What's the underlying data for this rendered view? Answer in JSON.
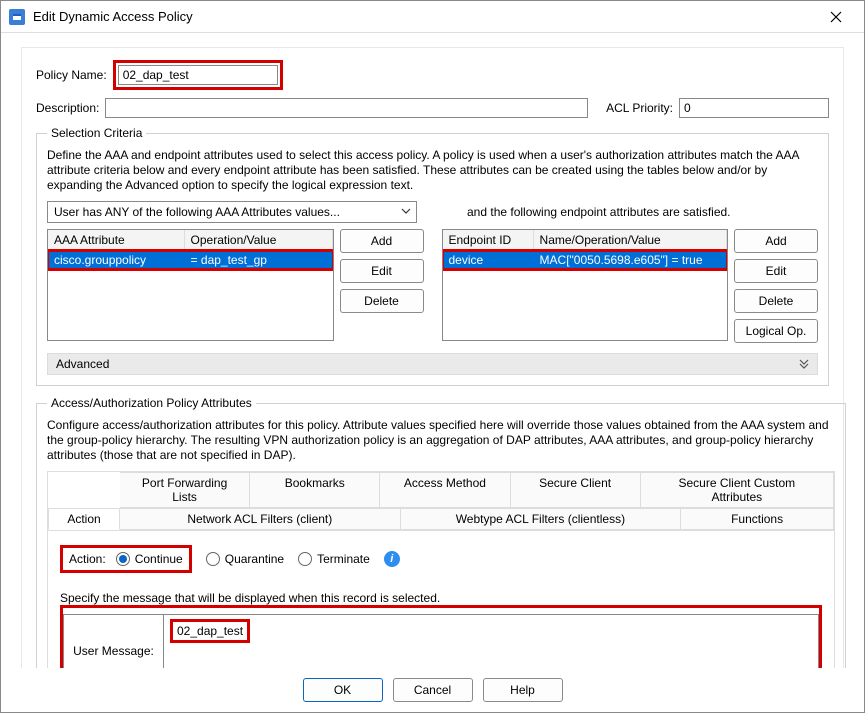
{
  "window": {
    "title": "Edit Dynamic Access Policy"
  },
  "form": {
    "policy_name_label": "Policy Name:",
    "policy_name_value": "02_dap_test",
    "description_label": "Description:",
    "description_value": "",
    "acl_priority_label": "ACL Priority:",
    "acl_priority_value": "0"
  },
  "selection": {
    "legend": "Selection Criteria",
    "intro": "Define the AAA and endpoint attributes used to select this access policy. A policy is used when a user's authorization attributes match the AAA attribute criteria below and every endpoint attribute has been satisfied. These attributes can be created using the tables below and/or by expanding the Advanced option to specify the logical expression text.",
    "dropdown": "User has ANY of the following AAA Attributes values...",
    "endpoint_note": "and the following endpoint attributes are satisfied.",
    "aaa_table": {
      "cols": [
        "AAA Attribute",
        "Operation/Value"
      ],
      "row": [
        "cisco.grouppolicy",
        "=   dap_test_gp"
      ]
    },
    "ep_table": {
      "cols": [
        "Endpoint ID",
        "Name/Operation/Value"
      ],
      "row": [
        "device",
        "MAC[\"0050.5698.e605\"]  =  true"
      ]
    },
    "buttons": {
      "add": "Add",
      "edit": "Edit",
      "delete": "Delete",
      "logical": "Logical Op."
    },
    "advanced": "Advanced"
  },
  "access": {
    "legend": "Access/Authorization Policy Attributes",
    "intro": "Configure access/authorization attributes for this policy. Attribute values specified here will override those values obtained from the AAA system and the group-policy hierarchy. The resulting VPN authorization policy is an aggregation of DAP attributes, AAA attributes, and group-policy hierarchy attributes (those that are not specified in DAP).",
    "tabs_row1": [
      "Port Forwarding Lists",
      "Bookmarks",
      "Access Method",
      "Secure Client",
      "Secure Client Custom Attributes"
    ],
    "tabs_row2": [
      "Action",
      "Network ACL Filters (client)",
      "Webtype ACL Filters (clientless)",
      "Functions"
    ],
    "action_label": "Action:",
    "radios": {
      "continue": "Continue",
      "quarantine": "Quarantine",
      "terminate": "Terminate"
    },
    "msg_prompt": "Specify the message that will be displayed when this record is selected.",
    "msg_label": "User Message:",
    "msg_value": "02_dap_test"
  },
  "footer": {
    "ok": "OK",
    "cancel": "Cancel",
    "help": "Help"
  }
}
